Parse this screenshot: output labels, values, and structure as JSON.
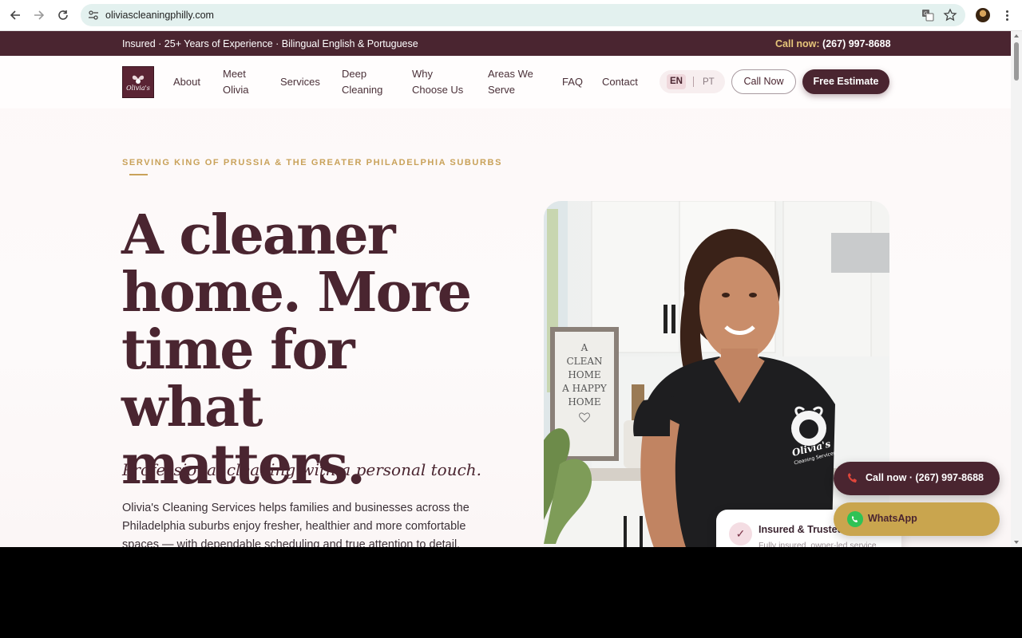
{
  "browser": {
    "url": "oliviascleaningphilly.com",
    "icons": {
      "back": "arrow-left-icon",
      "forward": "arrow-right-icon",
      "reload": "reload-icon",
      "site_info": "tune-icon",
      "translate": "translate-icon",
      "bookmark": "star-icon",
      "profile": "avatar",
      "menu": "more-vertical-icon"
    }
  },
  "topbar": {
    "info": "Insured · 25+ Years of Experience · Bilingual English & Portuguese",
    "call_label": "Call now:",
    "phone": "(267) 997-8688"
  },
  "logo": {
    "text": "Olivia's"
  },
  "nav": {
    "items": [
      {
        "label": "About"
      },
      {
        "label": "Meet Olivia"
      },
      {
        "label": "Services"
      },
      {
        "label": "Deep Cleaning"
      },
      {
        "label": "Why Choose Us"
      },
      {
        "label": "Areas We Serve"
      },
      {
        "label": "FAQ"
      },
      {
        "label": "Contact"
      }
    ],
    "lang_en": "EN",
    "lang_pt": "PT",
    "lang_selected": "EN",
    "call_button": "Call Now",
    "estimate_button": "Free Estimate"
  },
  "hero": {
    "eyebrow": "SERVING KING OF PRUSSIA & THE GREATER PHILADELPHIA SUBURBS",
    "headline": "A cleaner home. More time for what matters.",
    "tagline": "Professional cleaning with a personal touch.",
    "intro": "Olivia's Cleaning Services helps families and businesses across the Philadelphia suburbs enjoy fresher, healthier and more comfortable spaces — with dependable scheduling and true attention to detail.",
    "photo_sign": [
      "A",
      "CLEAN",
      "HOME",
      "A HAPPY",
      "HOME"
    ],
    "shirt_logo": "Olivia's",
    "shirt_logo_sub": "Cleaning Services"
  },
  "trust_card": {
    "title": "Insured & Trusted",
    "subtitle": "Fully insured, owner-led service"
  },
  "floating": {
    "call_label": "Call now · (267) 997-8688",
    "whatsapp_label": "WhatsApp"
  },
  "colors": {
    "brand": "#4a2530",
    "gold": "#c9a25a",
    "whatsapp": "#2ec255"
  }
}
